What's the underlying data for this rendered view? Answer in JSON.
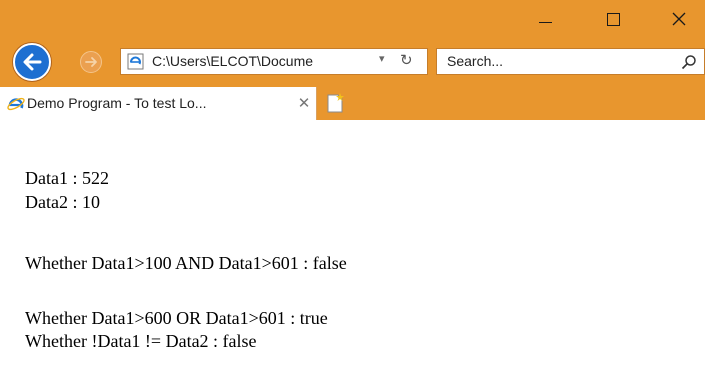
{
  "window": {
    "minimize_icon": "minimize-icon",
    "maximize_icon": "maximize-icon",
    "close_label": "✕"
  },
  "nav": {
    "address": "C:\\Users\\ELCOT\\Docume",
    "dropdown_glyph": "▾",
    "refresh_glyph": "↻",
    "search_placeholder": "Search..."
  },
  "tab": {
    "title": "Demo Program - To test Lo...",
    "close_label": "✕"
  },
  "content": {
    "lines": [
      "Data1 : 522",
      "Data2 : 10",
      "Whether Data1>100 AND Data1>601 : false",
      "Whether Data1>600 OR Data1>601 : true",
      "Whether !Data1 != Data2 : false"
    ]
  },
  "colors": {
    "chrome": "#e8962e",
    "back_button": "#1e6fd1"
  }
}
